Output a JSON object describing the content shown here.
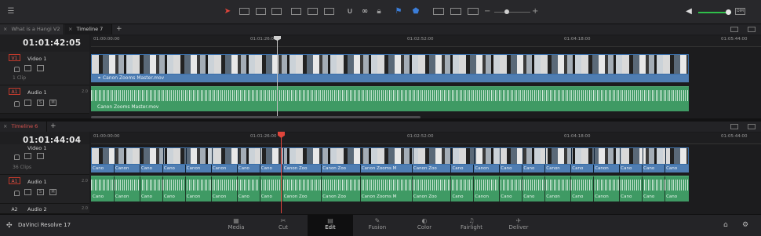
{
  "app": {
    "name": "DaVinci Resolve 17"
  },
  "colors": {
    "accent_red": "#e0453b",
    "video_clip": "#4f7eb3",
    "audio_clip": "#3f9a64",
    "volume_green": "#2fbf4a"
  },
  "toolbar": {
    "icons": [
      "menu-icon",
      "selection-pointer-icon",
      "trim-edit-icon",
      "dynamic-trim-icon",
      "blade-icon",
      "insert-clip-icon",
      "overwrite-clip-icon",
      "replace-clip-icon",
      "snapping-icon",
      "linked-selection-icon",
      "position-lock-icon",
      "flag-icon",
      "marker-icon",
      "zoom-full-icon",
      "zoom-detail-icon",
      "zoom-custom-icon",
      "zoom-out-icon",
      "zoom-in-icon",
      "speaker-icon",
      "dim-icon"
    ],
    "dim_label": "DIM",
    "zoom_minus": "−",
    "zoom_plus": "+"
  },
  "top_panel": {
    "tabs": [
      {
        "label": "What is a Hangi V2",
        "active": false
      },
      {
        "label": "Timeline 7",
        "active": true
      }
    ],
    "timecode": "01:01:42:05",
    "ruler": [
      "01:00:00:00",
      "01:01:26:00",
      "01:02:52:00",
      "01:04:18:00",
      "01:05:44:00"
    ],
    "video_track": {
      "badge": "V1",
      "name": "Video 1",
      "clips": "1 Clip",
      "clip_label": "Canon Zooms Master.mov"
    },
    "audio_track": {
      "badge": "A1",
      "name": "Audio 1",
      "volume": "2.0",
      "s": "S",
      "m": "M",
      "clip_label": "Canon Zooms Master.mov"
    }
  },
  "bottom_panel": {
    "tabs": [
      {
        "label": "Timeline 6"
      }
    ],
    "timecode": "01:01:44:04",
    "ruler": [
      "01:00:00:00",
      "01:01:26:00",
      "01:02:52:00",
      "01:04:18:00",
      "01:05:44:00"
    ],
    "video_track": {
      "name": "Video 1",
      "clips": "36 Clips",
      "segments": [
        "Cano",
        "Canon",
        "Cano",
        "Cano",
        "Canon",
        "Canon",
        "Cano",
        "Cano",
        "Canon Zoo",
        "Canon Zoo",
        "Canon Zooms M",
        "Canon Zoo",
        "Cano",
        "Canon",
        "Cano",
        "Cano",
        "Canon",
        "Cano",
        "Canon",
        "Cano",
        "Cano",
        "Cano"
      ]
    },
    "audio_track": {
      "badge": "A1",
      "name": "Audio 1",
      "volume": "2.0",
      "s": "S",
      "m": "M",
      "segments": [
        "Cano",
        "Canon",
        "Cano",
        "Cano",
        "Canon",
        "Canon",
        "Cano",
        "Cano",
        "Canon Zoo",
        "Canon Zoo",
        "Canon Zooms M",
        "Canon Zoo",
        "Cano",
        "Canon",
        "Cano",
        "Cano",
        "Canon",
        "Cano",
        "Canon",
        "Cano",
        "Cano",
        "Cano"
      ]
    },
    "audio_track_2": {
      "badge": "A2",
      "name": "Audio 2",
      "volume": "2.0"
    }
  },
  "pages": [
    {
      "label": "Media",
      "icon": "media-icon",
      "active": false
    },
    {
      "label": "Cut",
      "icon": "cut-icon",
      "active": false
    },
    {
      "label": "Edit",
      "icon": "edit-icon",
      "active": true
    },
    {
      "label": "Fusion",
      "icon": "fusion-icon",
      "active": false
    },
    {
      "label": "Color",
      "icon": "color-icon",
      "active": false
    },
    {
      "label": "Fairlight",
      "icon": "fairlight-icon",
      "active": false
    },
    {
      "label": "Deliver",
      "icon": "deliver-icon",
      "active": false
    }
  ],
  "bottom_right_icons": [
    "home-icon",
    "settings-icon"
  ]
}
